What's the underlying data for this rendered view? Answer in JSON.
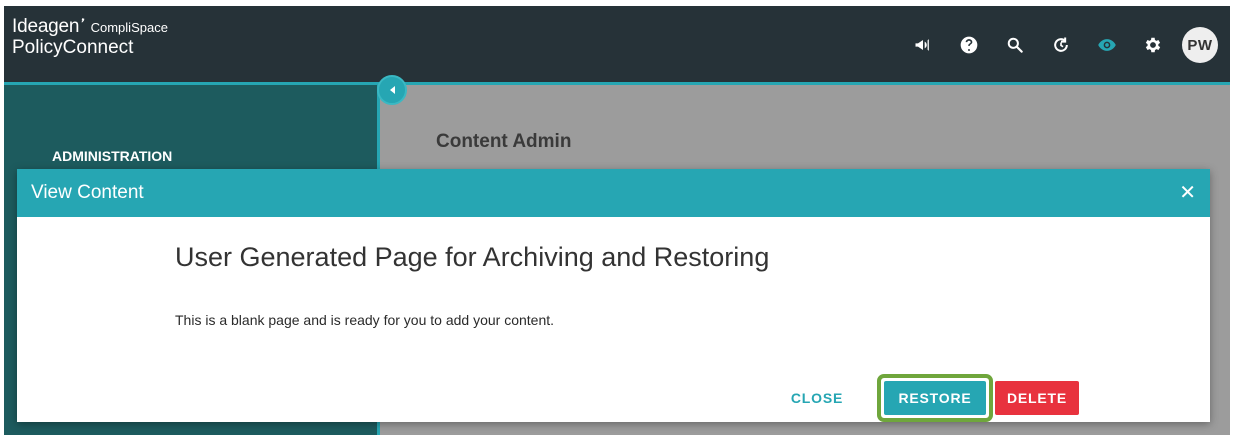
{
  "app": {
    "brand": "Ideagen",
    "brand_sub": "CompliSpace",
    "product": "PolicyConnect"
  },
  "header": {
    "icons": [
      "megaphone-icon",
      "help-icon",
      "search-icon",
      "history-icon",
      "eye-icon",
      "gear-icon"
    ],
    "avatar_initials": "PW"
  },
  "sidebar": {
    "title": "ADMINISTRATION"
  },
  "main": {
    "title": "Content Admin"
  },
  "modal": {
    "title": "View Content",
    "close_glyph": "✕",
    "heading": "User Generated Page for Archiving and Restoring",
    "body": "This is a blank page and is ready for you to add your content.",
    "buttons": {
      "close": "CLOSE",
      "restore": "RESTORE",
      "delete": "DELETE"
    }
  },
  "colors": {
    "topbar": "#263238",
    "accent": "#26a6b3",
    "sidebar": "#1d5b5e",
    "delete": "#e8323e",
    "highlight": "#6fa63c"
  }
}
